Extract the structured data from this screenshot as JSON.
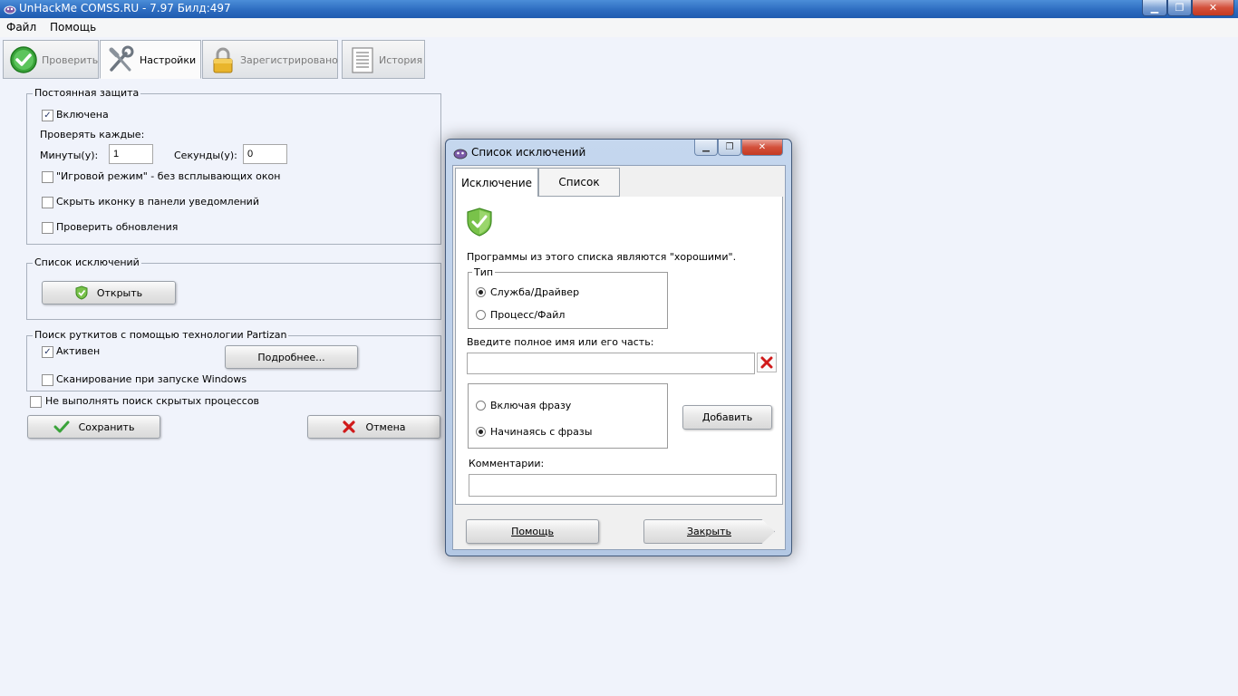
{
  "window": {
    "title": "UnHackMe COMSS.RU - 7.97 Билд:497",
    "controls": {
      "minimize": "▁",
      "maximize": "❐",
      "close": "✕"
    }
  },
  "menu": {
    "items": [
      "Файл",
      "Помощь"
    ]
  },
  "toolbar": {
    "tabs": [
      {
        "label": "Проверить",
        "icon": "check-circle-icon",
        "active": false
      },
      {
        "label": "Настройки",
        "icon": "tools-icon",
        "active": true
      },
      {
        "label": "Зарегистрировано",
        "icon": "lock-icon",
        "active": false
      },
      {
        "label": "История",
        "icon": "history-list-icon",
        "active": false
      }
    ]
  },
  "settings": {
    "protection": {
      "legend": "Постоянная защита",
      "enabled_label": "Включена",
      "enabled_checked": true,
      "check_every_label": "Проверять каждые:",
      "minutes_label": "Минуты(у):",
      "minutes_value": "1",
      "seconds_label": "Секунды(у):",
      "seconds_value": "0",
      "game_mode_label": "\"Игровой режим\" - без всплывающих окон",
      "game_mode_checked": false,
      "hide_icon_label": "Скрыть иконку в панели уведомлений",
      "hide_icon_checked": false,
      "check_updates_label": "Проверить обновления",
      "check_updates_checked": false
    },
    "exclusions": {
      "legend": "Список исключений",
      "open_label": "Открыть"
    },
    "rootkit": {
      "legend": "Поиск руткитов с помощью технологии Partizan",
      "active_label": "Активен",
      "active_checked": true,
      "more_label": "Подробнее...",
      "scan_startup_label": "Сканирование при запуске Windows",
      "scan_startup_checked": false
    },
    "no_hidden_label": "Не выполнять поиск скрытых процессов",
    "no_hidden_checked": false,
    "save_label": "Сохранить",
    "cancel_label": "Отмена"
  },
  "dialog": {
    "title": "Список исключений",
    "tabs": [
      {
        "label": "Исключение",
        "active": true
      },
      {
        "label": "Список",
        "active": false
      }
    ],
    "description": "Программы из этого списка являются \"хорошими\".",
    "type_legend": "Тип",
    "type_options": [
      {
        "label": "Служба/Драйвер",
        "selected": true
      },
      {
        "label": "Процесс/Файл",
        "selected": false
      }
    ],
    "name_label": "Введите полное имя или его часть:",
    "name_value": "",
    "match_options": [
      {
        "label": "Включая фразу",
        "selected": false
      },
      {
        "label": "Начинаясь с фразы",
        "selected": true
      }
    ],
    "add_label": "Добавить",
    "comment_label": "Комментарии:",
    "comment_value": "",
    "help_label": "Помощь",
    "close_label": "Закрыть"
  },
  "colors": {
    "titlebar": "#2d6cc0",
    "background": "#f0f3fb",
    "accent_green": "#3aa33a",
    "danger_red": "#d01a1a"
  }
}
